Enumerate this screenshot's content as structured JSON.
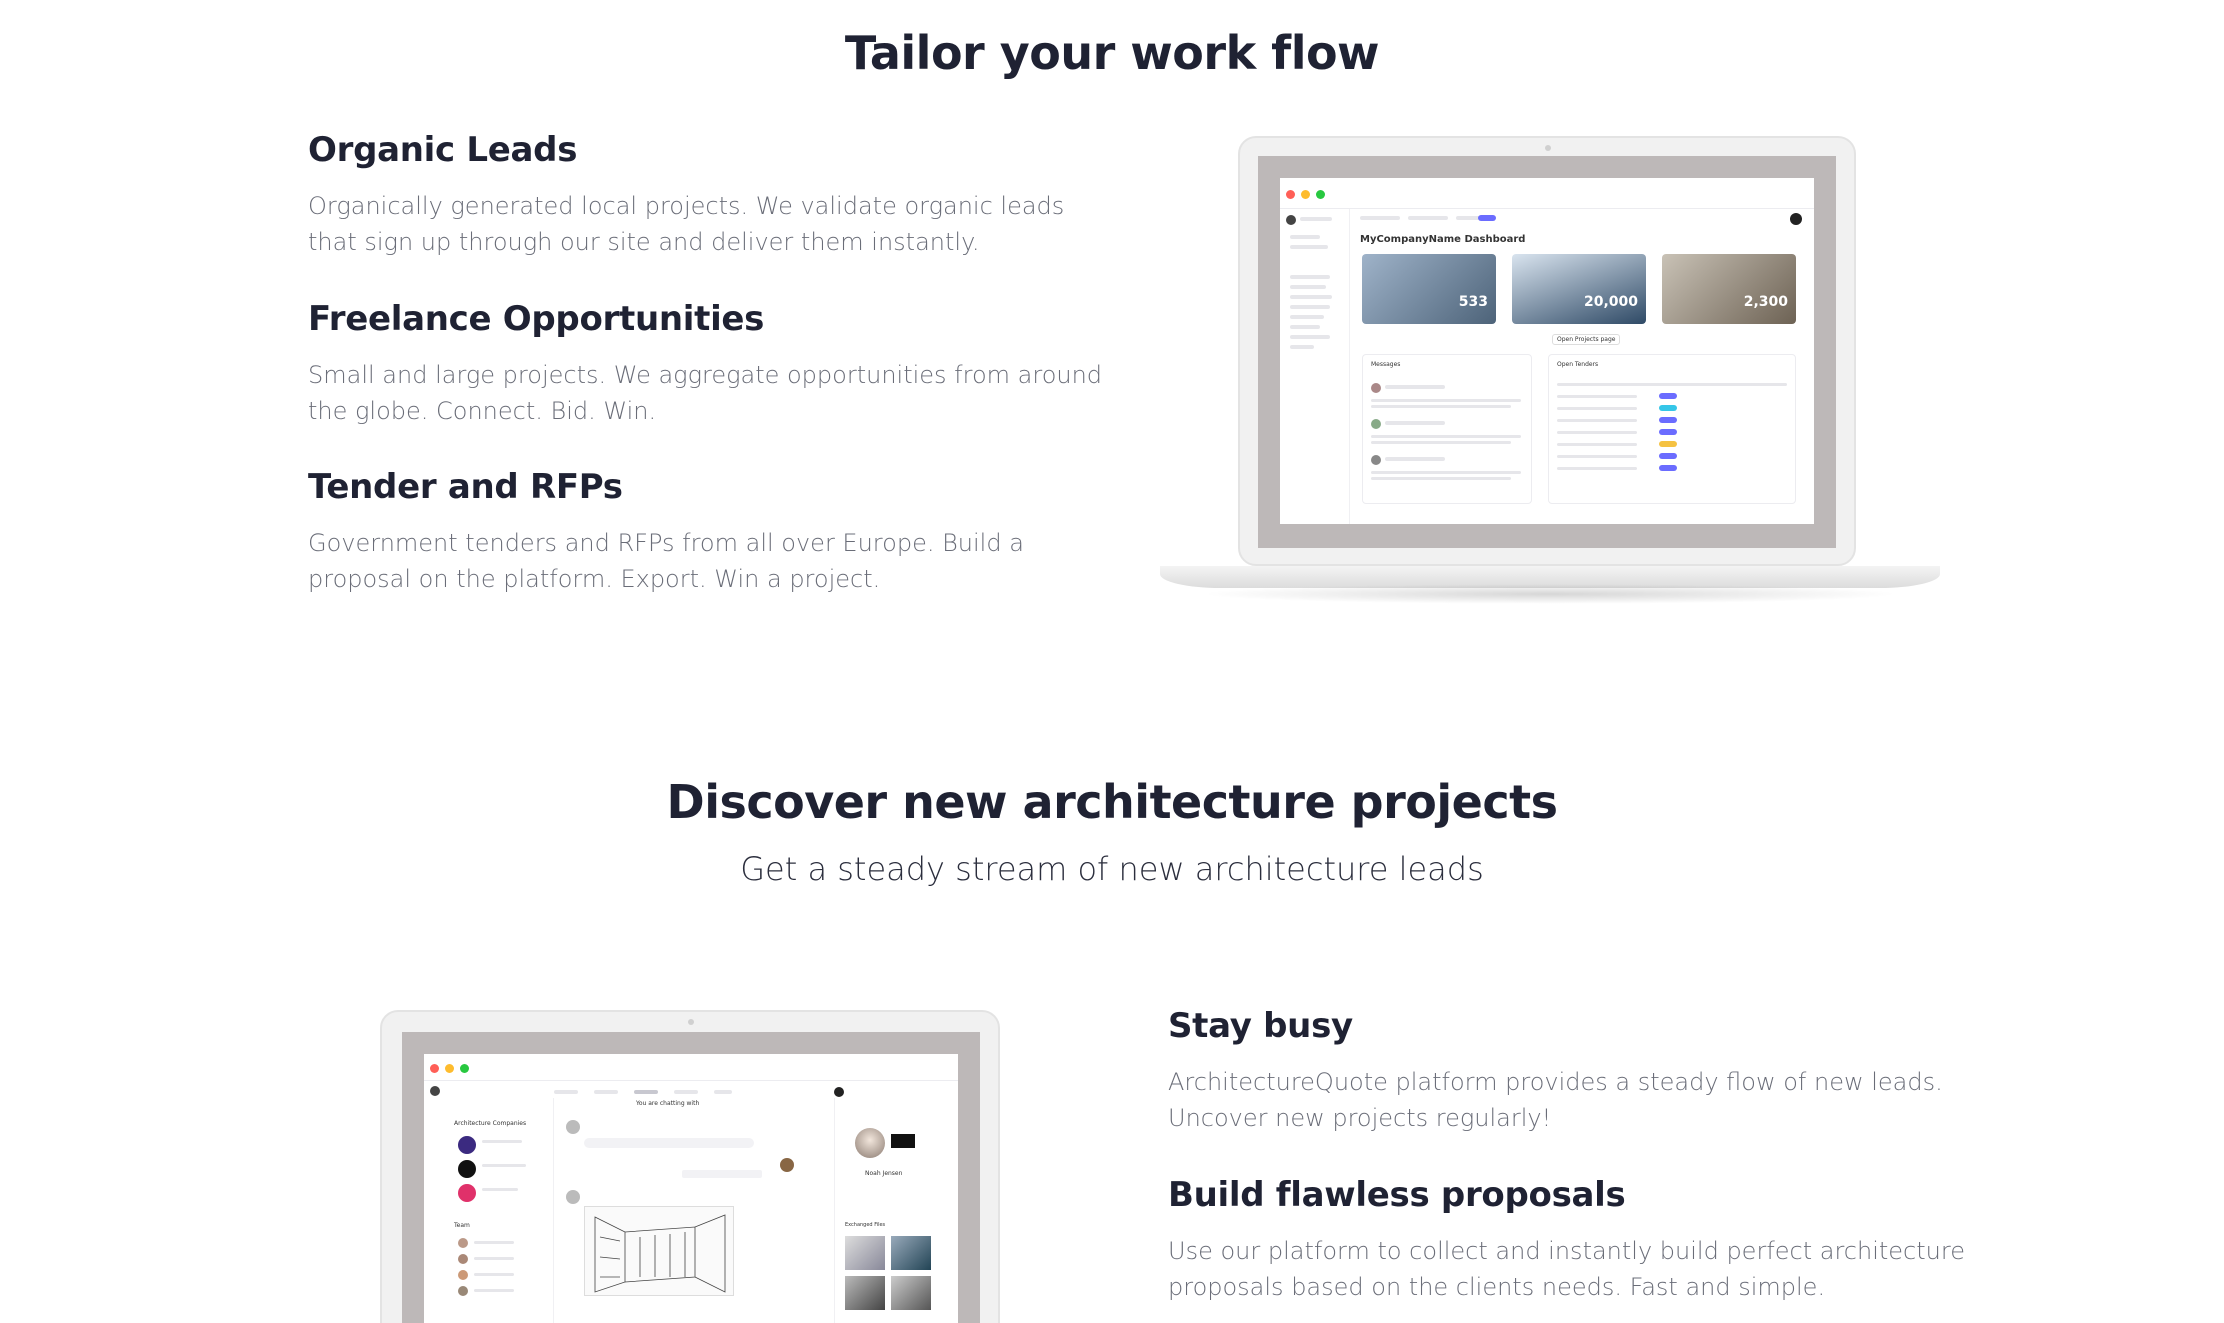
{
  "section1": {
    "title": "Tailor your work flow",
    "features": [
      {
        "title": "Organic Leads",
        "text": "Organically generated local projects. We validate organic leads that sign up through our site and deliver them instantly."
      },
      {
        "title": "Freelance Opportunities",
        "text": "Small and large projects. We aggregate opportunities from around the globe. Connect. Bid. Win."
      },
      {
        "title": "Tender and RFPs",
        "text": "Government tenders and RFPs from all over Europe. Build a proposal on the platform. Export. Win a project."
      }
    ],
    "dashboard": {
      "heading": "MyCompanyName Dashboard",
      "stats": [
        "533",
        "20,000",
        "2,300"
      ],
      "panel_messages": "Messages",
      "panel_tenders": "Open Tenders",
      "button": "Open Projects page",
      "colors": {
        "red": "#ff5f57",
        "yellow": "#febc2e",
        "green": "#28c840",
        "accent": "#6b6cff",
        "teal": "#35c6e8"
      }
    }
  },
  "section2": {
    "title": "Discover new architecture projects",
    "subtitle": "Get a steady stream of new architecture leads",
    "features": [
      {
        "title": "Stay busy",
        "text": "ArchitectureQuote platform provides a steady flow of new leads. Uncover new projects regularly!"
      },
      {
        "title": "Build flawless proposals",
        "text": "Use our platform to collect and instantly build perfect architecture proposals based on the clients needs. Fast and simple."
      }
    ],
    "chat": {
      "sidebar_title": "Architecture Companies",
      "chatting_with": "You are chatting with",
      "team_label": "Team",
      "profile_name": "Noah Jensen",
      "files_label": "Exchanged Files"
    }
  }
}
